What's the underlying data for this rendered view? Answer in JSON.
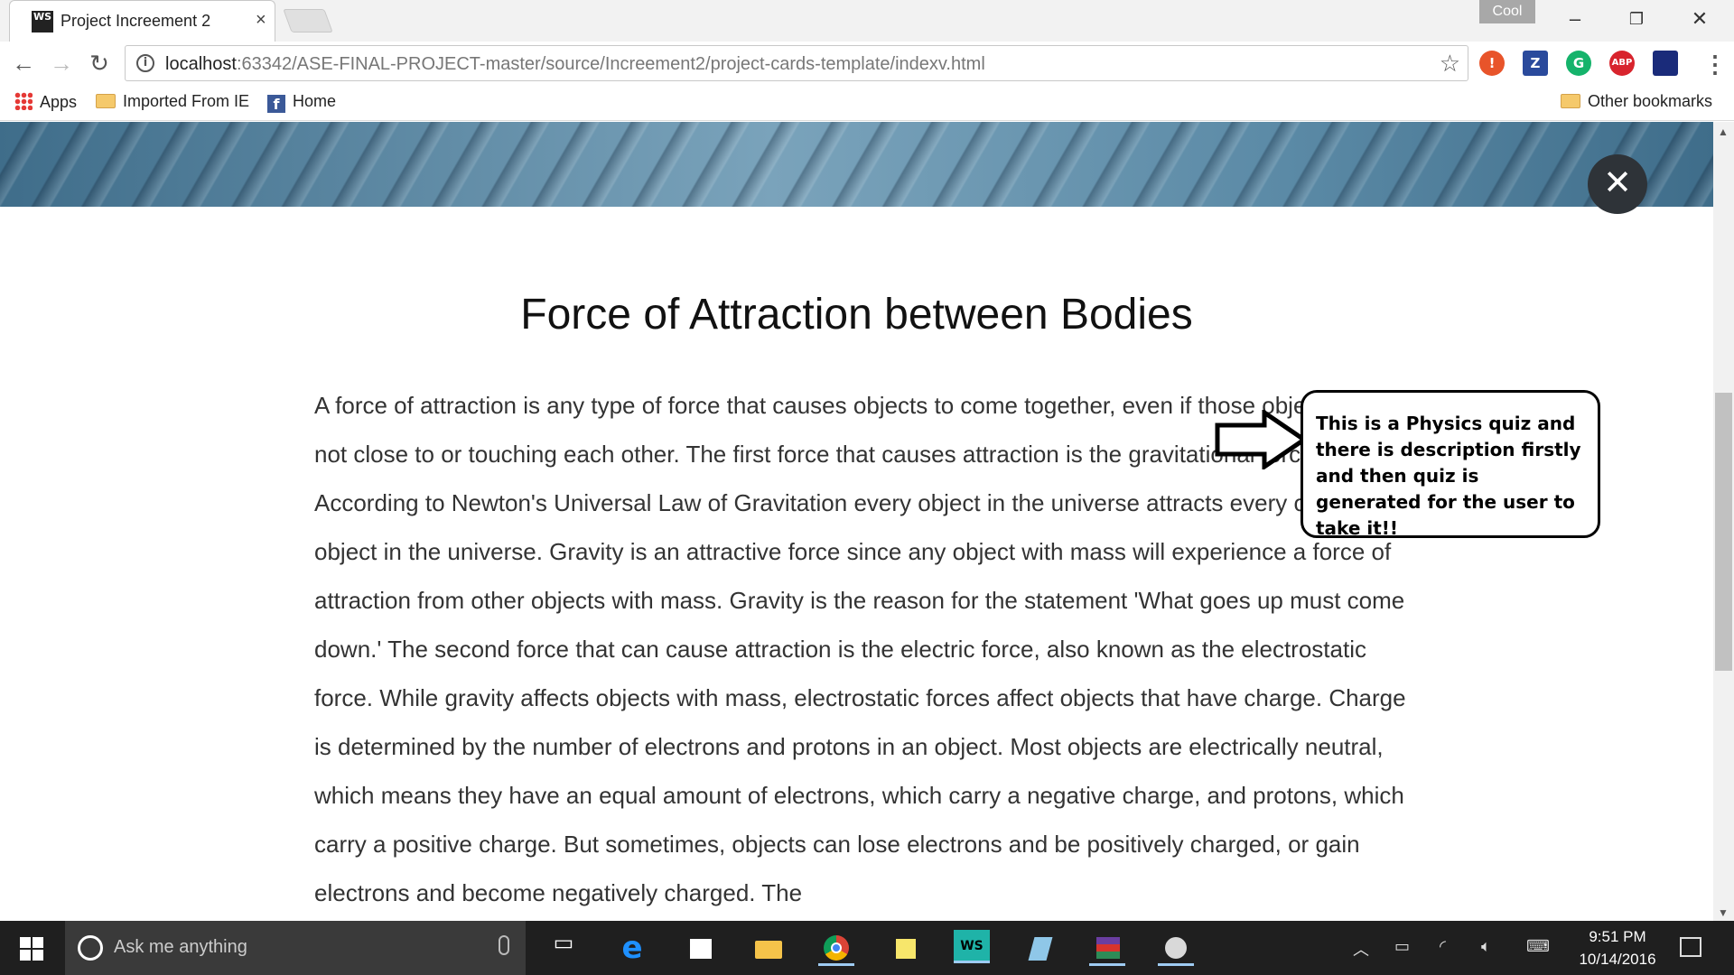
{
  "browser": {
    "tab_favicon": "WS",
    "tab_title": "Project Increement 2",
    "tab_close": "×",
    "profile_name": "Cool",
    "url_host": "localhost",
    "url_path": ":63342/ASE-FINAL-PROJECT-master/source/Increement2/project-cards-template/indexv.html",
    "extensions": [
      {
        "name": "adblock-alert",
        "glyph": "!",
        "color": "#e8542a"
      },
      {
        "name": "zotero",
        "glyph": "Z",
        "color": "#2a4a9c"
      },
      {
        "name": "grammarly",
        "glyph": "G",
        "color": "#15b36b"
      },
      {
        "name": "abp",
        "glyph": "ABP",
        "color": "#d8242d"
      }
    ]
  },
  "bookmarks": {
    "apps": "Apps",
    "imported": "Imported From IE",
    "fb_glyph": "f",
    "home": "Home",
    "other": "Other bookmarks"
  },
  "page": {
    "close_glyph": "✕",
    "title": "Force of Attraction between Bodies",
    "body": "A force of attraction is any type of force that causes objects to come together, even if those objects are not close to or touching each other. The first force that causes attraction is the gravitational force. According to Newton's Universal Law of Gravitation every object in the universe attracts every other object in the universe. Gravity is an attractive force since any object with mass will experience a force of attraction from other objects with mass. Gravity is the reason for the statement 'What goes up must come down.' The second force that can cause attraction is the electric force, also known as the electrostatic force. While gravity affects objects with mass, electrostatic forces affect objects that have charge. Charge is determined by the number of electrons and protons in an object. Most objects are electrically neutral, which means they have an equal amount of electrons, which carry a negative charge, and protons, which carry a positive charge. But sometimes, objects can lose electrons and be positively charged, or gain electrons and become negatively charged. The",
    "annotation": "This is  a Physics quiz and there is description firstly and then quiz is generated for the user to take it!!"
  },
  "taskbar": {
    "search_placeholder": "Ask me anything",
    "ws_glyph": "WS",
    "time": "9:51 PM",
    "date": "10/14/2016"
  }
}
